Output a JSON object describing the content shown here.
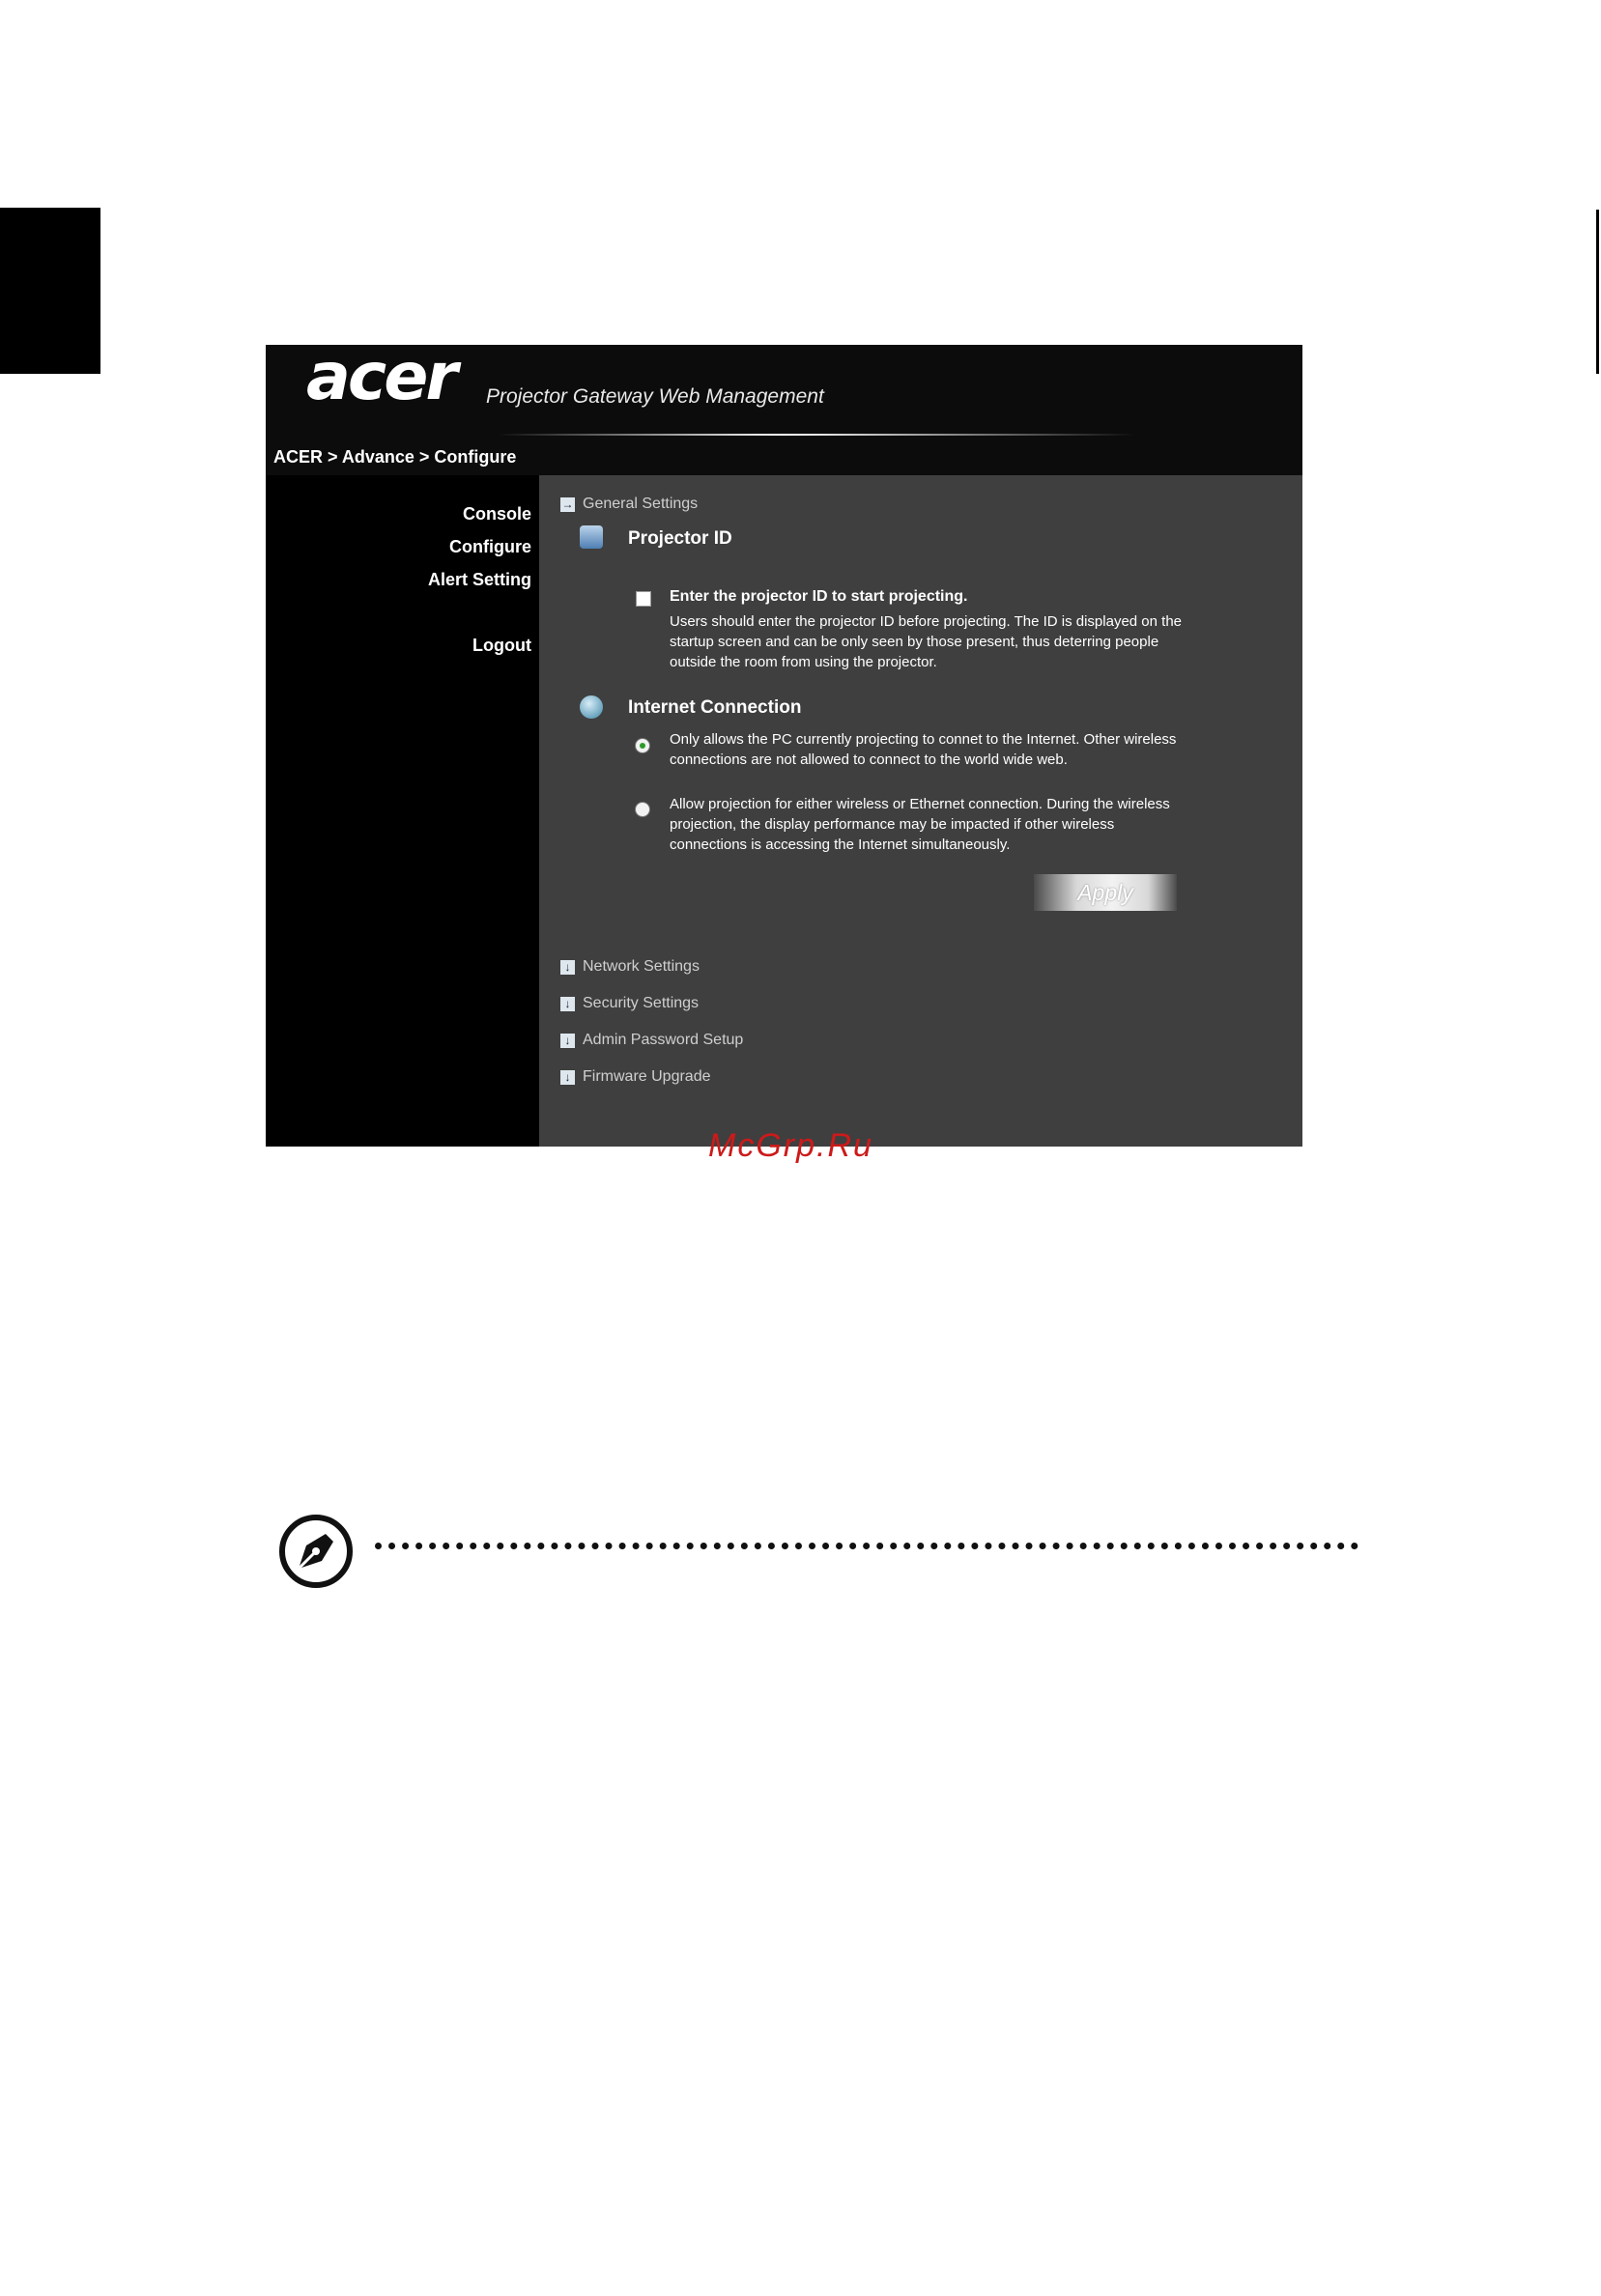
{
  "app": {
    "logo": "acer",
    "title": "Projector Gateway Web Management",
    "breadcrumb": "ACER > Advance > Configure"
  },
  "nav": {
    "console": "Console",
    "configure": "Configure",
    "alert_setting": "Alert Setting",
    "logout": "Logout"
  },
  "sections": {
    "general": "General Settings",
    "network": "Network Settings",
    "security": "Security Settings",
    "admin": "Admin Password Setup",
    "firmware": "Firmware Upgrade"
  },
  "projector_id": {
    "title": "Projector ID",
    "checkbox_label": "Enter the projector ID to start projecting.",
    "checked": false,
    "description": "Users should enter the projector ID before projecting. The ID is displayed on the startup screen and can be only seen by those present, thus deterring people outside the room from using the projector."
  },
  "internet": {
    "title": "Internet Connection",
    "option1": "Only allows the PC currently projecting to connet to the Internet. Other wireless connections are not allowed to connect to the world wide web.",
    "option2": "Allow projection for either wireless or Ethernet connection. During the wireless projection, the display performance may be impacted if other wireless connections is accessing the Internet simultaneously.",
    "selected": 1
  },
  "apply_label": "Apply",
  "watermark": "McGrp.Ru",
  "colors": {
    "content_bg": "#3f3f3f",
    "sidebar_bg": "#000000",
    "radio_selected": "#2e9a27"
  },
  "icons": {
    "section_collapsed": "arrow-right-icon",
    "section_expand": "arrow-down-icon",
    "projector_id": "id-card-icon",
    "internet": "globe-icon",
    "note": "note-pen-icon"
  }
}
